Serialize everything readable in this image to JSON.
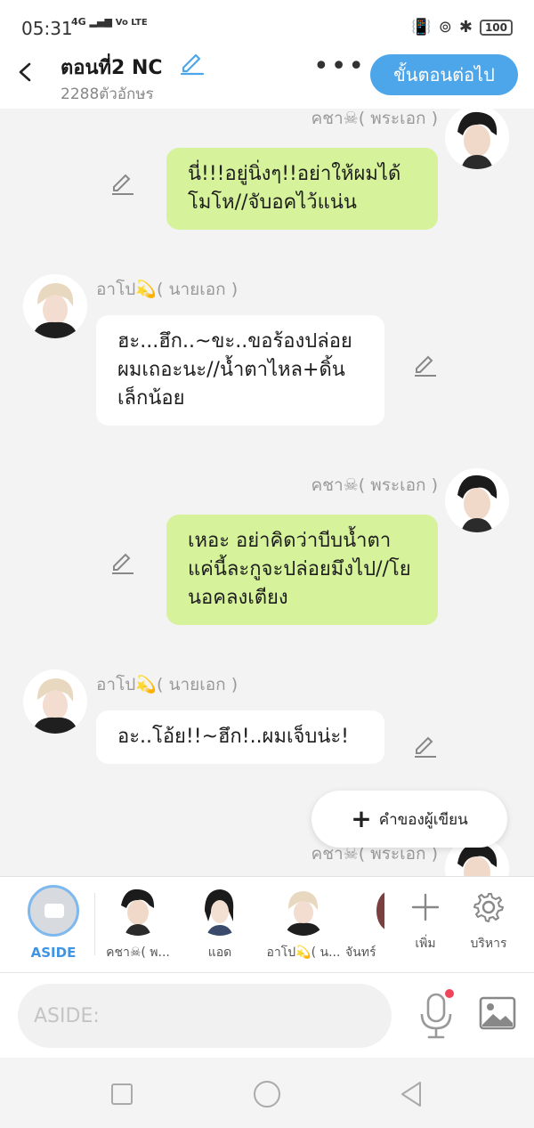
{
  "status": {
    "time": "05:31",
    "network": "4G",
    "volte": "Vo LTE",
    "battery": "100"
  },
  "header": {
    "title": "ตอนที่2 NC",
    "char_count": "2288ตัวอักษร",
    "next_label": "ขั้นตอนต่อไป"
  },
  "chat": {
    "messages": [
      {
        "side": "right",
        "name": "คชา☠( พระเอก )",
        "text": ""
      },
      {
        "side": "right",
        "name": "",
        "text": "นี่!!!อยู่นิ่งๆ!!อย่าให้ผมได้โมโห//จับอคไว้แน่น"
      },
      {
        "side": "left",
        "name": "อาโป💫( นายเอก )",
        "text": "ฮะ...ฮึก..~ขะ..ขอร้องปล่อยผมเถอะนะ//น้ำตาไหล+ดิ้นเล็กน้อย"
      },
      {
        "side": "right",
        "name": "คชา☠( พระเอก )",
        "text": "เหอะ อย่าคิดว่าบีบน้ำตาแค่นี้ละกูจะปล่อยมึงไป//โยนอคลงเตียง"
      },
      {
        "side": "left",
        "name": "อาโป💫( นายเอก )",
        "text": "อะ..โอ้ย!!~ฮึก!..ผมเจ็บน่ะ!"
      },
      {
        "side": "right",
        "name": "คชา☠( พระเอก )",
        "text": ""
      }
    ],
    "writer_button": "คำของผู้เขียน"
  },
  "charbar": {
    "aside_label": "ASIDE",
    "characters": [
      {
        "label": "คชา☠( พ..."
      },
      {
        "label": "แอด"
      },
      {
        "label": "อาโป💫( น..."
      },
      {
        "label": "จันทร์"
      }
    ],
    "add_label": "เพิ่ม",
    "manage_label": "บริหาร"
  },
  "input": {
    "placeholder": "ASIDE:"
  },
  "colors": {
    "accent": "#4ea6ea",
    "right_bubble": "#d6f29a",
    "left_bubble": "#ffffff",
    "background": "#f3f3f3"
  }
}
